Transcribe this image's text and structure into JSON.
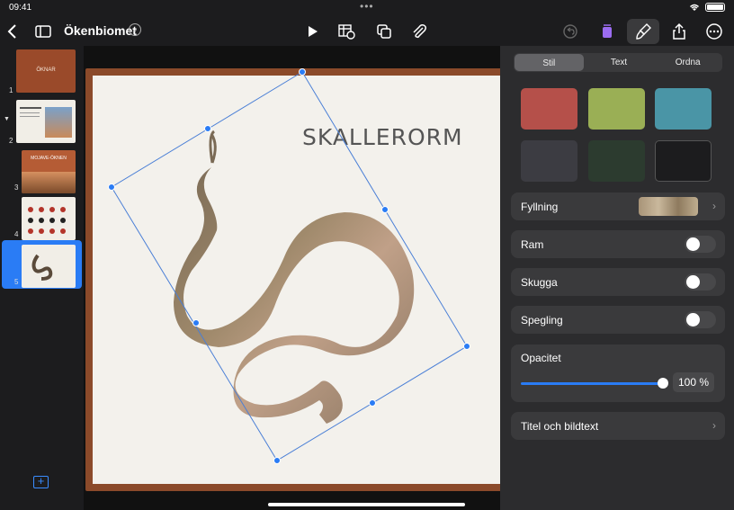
{
  "status": {
    "time": "09:41"
  },
  "toolbar": {
    "doc_title": "Ökenbiomet"
  },
  "navigator": {
    "slides": [
      {
        "number": "1",
        "label": "ÖKNAR"
      },
      {
        "number": "2"
      },
      {
        "number": "3",
        "label": "MOJAVE-ÖKNEN"
      },
      {
        "number": "4"
      },
      {
        "number": "5"
      }
    ],
    "selected": 5
  },
  "slide": {
    "title": "SKALLERORM"
  },
  "inspector": {
    "tabs": [
      "Stil",
      "Text",
      "Ordna"
    ],
    "active_tab": "Stil",
    "swatch_colors": [
      "#b5504a",
      "#9aaf55",
      "#4a95a6",
      "#3c3c42",
      "#2c3b2f",
      "#1c1c1e"
    ],
    "fill_label": "Fyllning",
    "border_label": "Ram",
    "shadow_label": "Skugga",
    "reflection_label": "Spegling",
    "opacity_label": "Opacitet",
    "opacity_value": "100 %",
    "caption_label": "Titel och bildtext"
  }
}
